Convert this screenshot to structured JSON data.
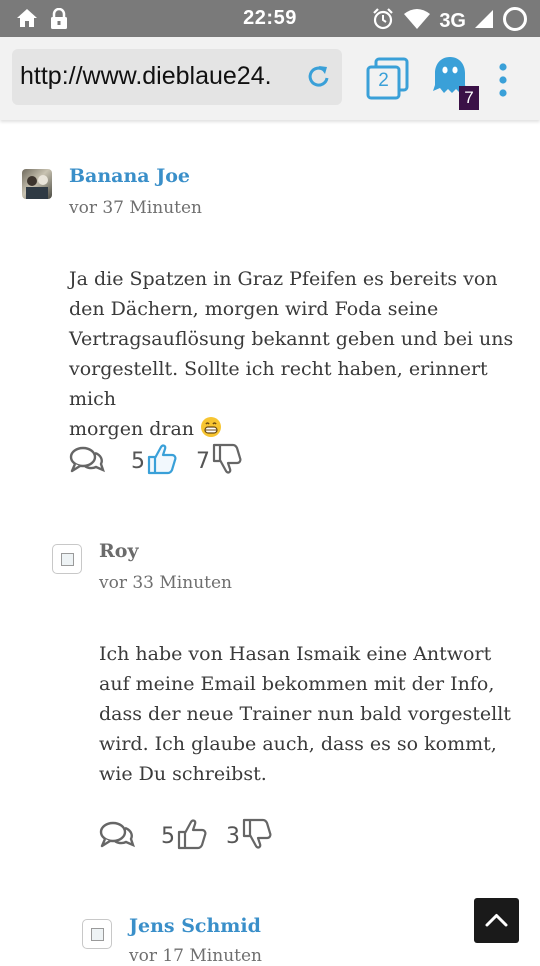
{
  "status_bar": {
    "time": "22:59",
    "network": "3G",
    "icons": [
      "home-icon",
      "lock-icon",
      "alarm-icon",
      "wifi-icon",
      "signal-icon",
      "sync-ring-icon"
    ]
  },
  "browser": {
    "url": "http://www.dieblaue24.",
    "tab_count": "2",
    "ghostery_count": "7",
    "accent_color": "#3aa0d8"
  },
  "comments": [
    {
      "author": "Banana Joe",
      "time": "vor 37 Minuten",
      "text_lines": [
        "Ja die Spatzen in Graz Pfeifen es bereits von",
        "den Dächern, morgen wird Foda seine",
        "Vertragsauflösung bekannt geben und bei uns",
        "vorgestellt. Sollte ich recht haben, erinnert mich",
        "morgen dran"
      ],
      "likes": "5",
      "dislikes": "7"
    },
    {
      "author": "Roy",
      "time": "vor 33 Minuten",
      "text_lines": [
        "Ich habe von Hasan Ismaik eine Antwort",
        "auf meine Email bekommen mit der Info,",
        "dass der neue Trainer nun bald vorgestellt",
        "wird. Ich glaube auch, dass es so kommt,",
        "wie Du schreibst."
      ],
      "likes": "5",
      "dislikes": "3"
    },
    {
      "author": "Jens Schmid",
      "time": "vor 17 Minuten"
    }
  ]
}
